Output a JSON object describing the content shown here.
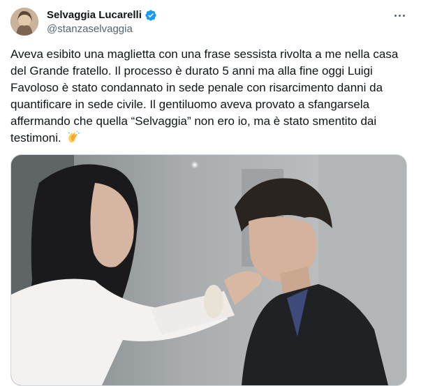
{
  "author": {
    "display_name": "Selvaggia Lucarelli",
    "handle": "@stanzaselvaggia",
    "verified": true,
    "verified_color": "#1d9bf0"
  },
  "menu": {
    "icon": "more-horizontal-icon"
  },
  "tweet": {
    "text": "Aveva esibito una maglietta con una frase sessista rivolta a me nella casa del Grande fratello. Il processo è durato 5 anni ma alla fine oggi Luigi Favoloso è stato condannato in sede penale con risarcimento danni da quantificare in sede civile. Il gentiluomo aveva provato a sfangarsela affermando che quella “Selvaggia” non ero io, ma è stato smentito dai testimoni.",
    "emoji": "clapping-hands-emoji"
  },
  "colors": {
    "text": "#0f1419",
    "secondary": "#536471",
    "border": "#cfd9de"
  }
}
